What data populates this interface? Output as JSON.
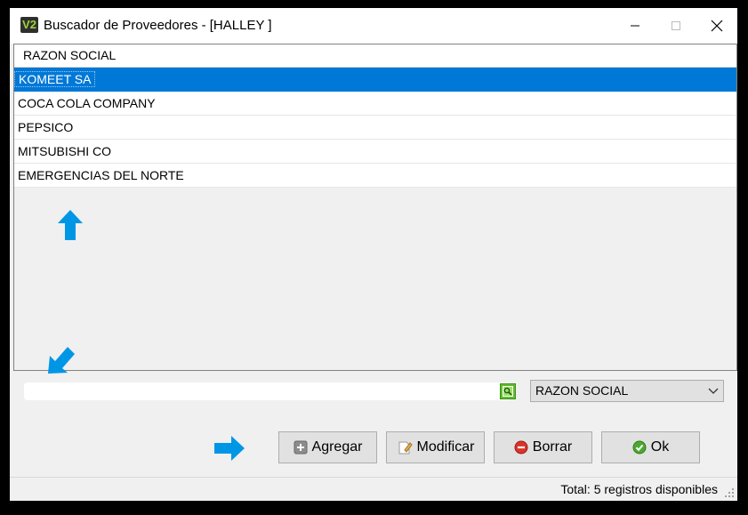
{
  "window": {
    "icon_text": "V2",
    "title": "Buscador de Proveedores - [HALLEY ]"
  },
  "grid": {
    "header": "RAZON SOCIAL",
    "rows": [
      "KOMEET SA",
      "COCA COLA COMPANY",
      "PEPSICO",
      "MITSUBISHI CO",
      "EMERGENCIAS DEL NORTE"
    ],
    "selected_index": 0
  },
  "search": {
    "value": "",
    "field_select": "RAZON SOCIAL"
  },
  "buttons": {
    "add": "Agregar",
    "modify": "Modificar",
    "delete": "Borrar",
    "ok": "Ok"
  },
  "status": {
    "text": "Total: 5 registros disponibles"
  },
  "colors": {
    "selection": "#0078d7",
    "annotation_arrow": "#0096e6"
  }
}
